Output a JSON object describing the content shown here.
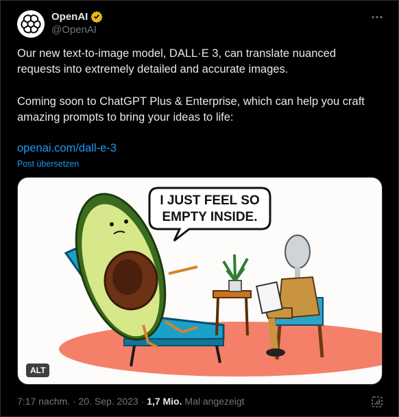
{
  "author": {
    "display_name": "OpenAI",
    "handle": "@OpenAI"
  },
  "post": {
    "paragraph1": "Our new text-to-image model, DALL·E 3, can translate nuanced requests into extremely detailed and accurate images.",
    "paragraph2": "Coming soon to ChatGPT Plus & Enterprise, which can help you craft amazing prompts to bring your ideas to life:",
    "link": "openai.com/dall-e-3",
    "translate": "Post übersetzen"
  },
  "media": {
    "speech_line1": "I JUST FEEL SO",
    "speech_line2": "EMPTY INSIDE.",
    "alt_badge": "ALT"
  },
  "meta": {
    "time": "7:17 nachm.",
    "sep1": " · ",
    "date": "20. Sep. 2023",
    "sep2": " · ",
    "views": "1,7 Mio.",
    "views_suffix": " Mal angezeigt"
  },
  "colors": {
    "background": "#000000",
    "text": "#e7e9ea",
    "secondary": "#71767b",
    "link": "#1d9bf0",
    "verified": "#e2b719"
  },
  "icons": [
    "openai-logo-icon",
    "verified-badge-icon",
    "more-icon",
    "view-stats-icon"
  ]
}
